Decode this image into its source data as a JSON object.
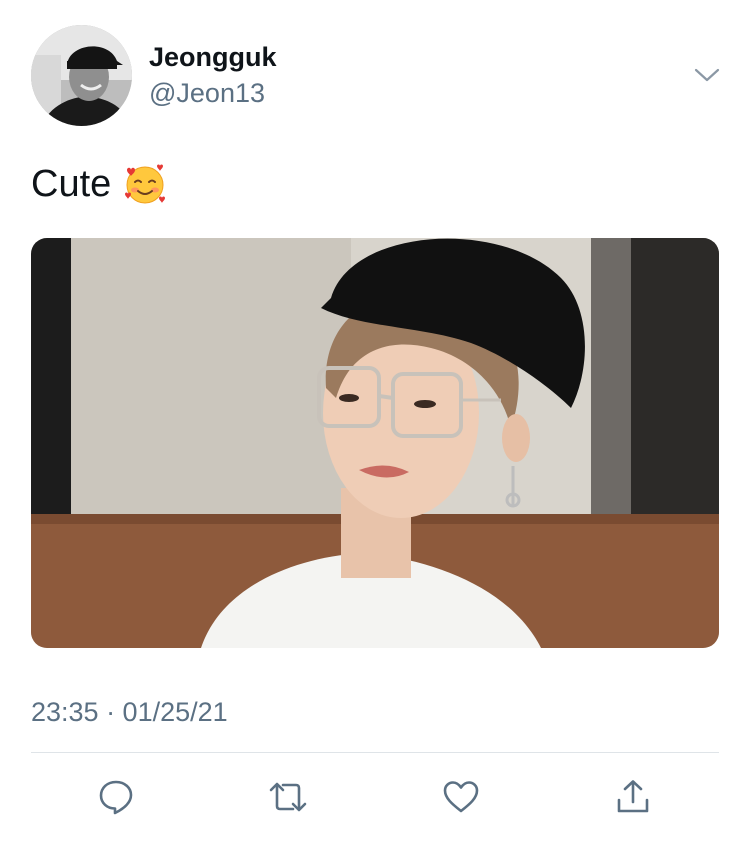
{
  "author": {
    "display_name": "Jeongguk",
    "handle": "@Jeon13",
    "avatar_icon": "profile-photo"
  },
  "tweet": {
    "text": "Cute",
    "emoji": "smiling-face-with-hearts",
    "timestamp": "23:35 · 01/25/21"
  },
  "media": {
    "description_icon": "photo"
  },
  "actions": {
    "reply_icon": "reply-icon",
    "retweet_icon": "retweet-icon",
    "like_icon": "like-icon",
    "share_icon": "share-icon"
  },
  "colors": {
    "text_primary": "#0f1419",
    "text_secondary": "#5b7083",
    "icon": "#5b7083",
    "divider": "#dfe4e8"
  }
}
